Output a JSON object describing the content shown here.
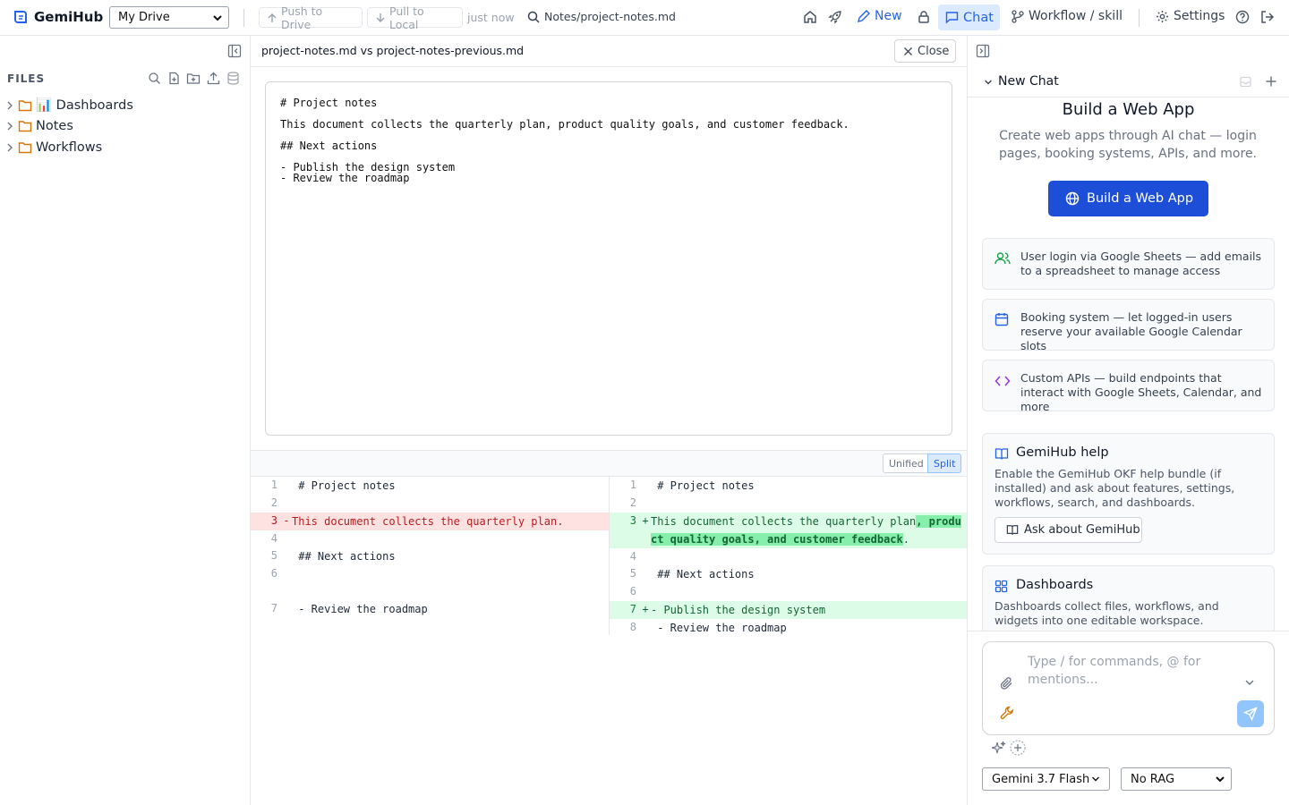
{
  "app": {
    "name": "GemiHub"
  },
  "header": {
    "drive_select": "My Drive",
    "push_label": "Push to Drive",
    "pull_label": "Pull to Local",
    "sync_status": "just now",
    "file_path": "Notes/project-notes.md",
    "new_label": "New",
    "chat_label": "Chat",
    "workflow_label": "Workflow / skill",
    "settings_label": "Settings"
  },
  "sidebar": {
    "files_title": "FILES",
    "items": [
      {
        "label": "📊 Dashboards"
      },
      {
        "label": "Notes"
      },
      {
        "label": "Workflows"
      }
    ]
  },
  "editor": {
    "title": "project-notes.md vs project-notes-previous.md",
    "close_label": "Close",
    "lines": [
      "# Project notes",
      "This document collects the quarterly plan, product quality goals, and customer feedback.",
      "## Next actions",
      "- Publish the design system\n- Review the roadmap"
    ]
  },
  "diff": {
    "unified_label": "Unified",
    "split_label": "Split",
    "left": [
      {
        "num": "1",
        "sign": "",
        "text": " # Project notes",
        "type": "ctx"
      },
      {
        "num": "2",
        "sign": "",
        "text": "",
        "type": "ctx"
      },
      {
        "num": "3",
        "sign": "-",
        "text": "This document collects the quarterly plan.",
        "type": "del"
      },
      {
        "num": "4",
        "sign": "",
        "text": "",
        "type": "ctx"
      },
      {
        "num": "5",
        "sign": "",
        "text": " ## Next actions",
        "type": "ctx"
      },
      {
        "num": "6",
        "sign": "",
        "text": "",
        "type": "ctx"
      },
      {
        "num": "",
        "sign": "",
        "text": "",
        "type": "blank"
      },
      {
        "num": "7",
        "sign": "",
        "text": " - Review the roadmap",
        "type": "ctx"
      }
    ],
    "right": [
      {
        "num": "1",
        "sign": "",
        "text": " # Project notes",
        "type": "ctx"
      },
      {
        "num": "2",
        "sign": "",
        "text": "",
        "type": "ctx"
      },
      {
        "num": "3",
        "sign": "+",
        "text": "This document collects the quarterly plan",
        "hl": ", product quality goals, and customer feedback",
        "tail": ".",
        "type": "add"
      },
      {
        "num": "4",
        "sign": "",
        "text": "",
        "type": "ctx"
      },
      {
        "num": "5",
        "sign": "",
        "text": " ## Next actions",
        "type": "ctx"
      },
      {
        "num": "6",
        "sign": "",
        "text": "",
        "type": "ctx"
      },
      {
        "num": "7",
        "sign": "+",
        "text": "- Publish the design system",
        "type": "add"
      },
      {
        "num": "8",
        "sign": "",
        "text": " - Review the roadmap",
        "type": "ctx"
      }
    ]
  },
  "chat": {
    "new_chat_label": "New Chat",
    "hero_title": "Build a Web App",
    "hero_desc": "Create web apps through AI chat — login pages, booking systems, APIs, and more.",
    "hero_button": "Build a Web App",
    "cards": [
      {
        "text": "User login via Google Sheets — add emails to a spreadsheet to manage access",
        "icon": "users-icon",
        "color": "#16a34a"
      },
      {
        "text": "Booking system — let logged-in users reserve your available Google Calendar slots",
        "icon": "calendar-icon",
        "color": "#2563eb"
      },
      {
        "text": "Custom APIs — build endpoints that interact with Google Sheets, Calendar, and more",
        "icon": "code-icon",
        "color": "#9333ea"
      }
    ],
    "help_title": "GemiHub help",
    "help_desc": "Enable the GemiHub OKF help bundle (if installed) and ask about features, settings, workflows, search, and dashboards.",
    "help_button": "Ask about GemiHub",
    "dash_title": "Dashboards",
    "dash_desc": "Dashboards collect files, workflows, and widgets into one editable workspace.",
    "input_placeholder": "Type / for commands, @ for mentions...",
    "model_select": "Gemini 3.7 Flash",
    "rag_select": "No RAG"
  },
  "colors": {
    "accent": "#1d4ed8",
    "chat_bg": "#dbeafe",
    "del_bg": "#fee2e2",
    "add_bg": "#dcfce7",
    "add_hl": "#86efac"
  }
}
